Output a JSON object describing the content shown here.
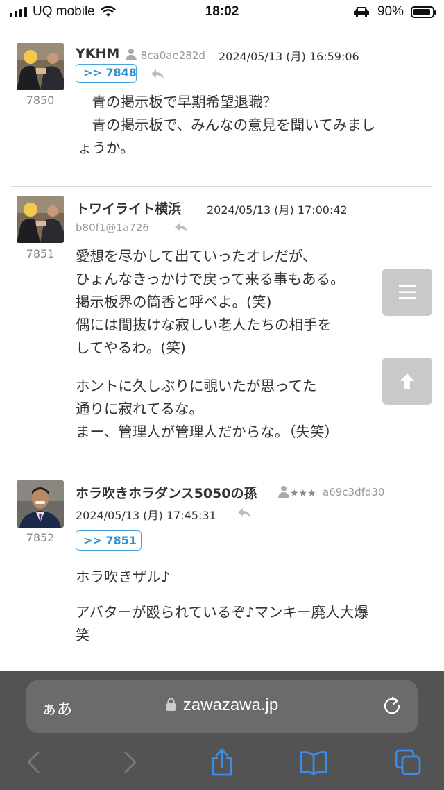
{
  "status_bar": {
    "carrier": "UQ mobile",
    "time": "18:02",
    "battery_percent": "90%"
  },
  "posts": [
    {
      "number": "7850",
      "author": "YKHM",
      "id": "8ca0ae282d",
      "date": "2024/05/13 (月) 16:59:06",
      "reply_to": ">> 7848",
      "paragraphs": [
        "　青の掲示板で早期希望退職？\n　青の掲示板で、みんなの意見を聞いてみまし\nょうか。"
      ]
    },
    {
      "number": "7851",
      "author": "トワイライト横浜",
      "id": "b80f1@1a726",
      "date": "2024/05/13 (月) 17:00:42",
      "paragraphs": [
        "愛想を尽かして出ていったオレだが、\nひょんなきっかけで戻って来る事もある。\n掲示板界の筒香と呼べよ。(笑)\n偶には間抜けな寂しい老人たちの相手を\nしてやるわ。(笑)",
        "ホントに久しぶりに覗いたが思ってた\n通りに寂れてるな。\nまー、管理人が管理人だからな。（失笑）"
      ]
    },
    {
      "number": "7852",
      "author": "ホラ吹きホラダンス5050の孫",
      "rank_stars": "★★★",
      "id": "a69c3dfd30",
      "date": "2024/05/13 (月) 17:45:31",
      "reply_to": ">> 7851",
      "paragraphs": [
        "ホラ吹きザル♪",
        "アバターが殴られているぞ♪マンキー廃人大爆\n笑"
      ]
    }
  ],
  "browser": {
    "text_size_label": "ぁあ",
    "url": "zawazawa.jp"
  },
  "icons": {
    "menu": "menu-icon",
    "scroll_top": "arrow-up-icon",
    "reply": "reply-arrow-icon",
    "user": "person-icon",
    "lock": "lock-icon",
    "reload": "reload-icon",
    "back": "back-arrow-icon",
    "forward": "forward-arrow-icon",
    "share": "share-icon",
    "bookmarks": "book-icon",
    "tabs": "tabs-icon"
  },
  "colors": {
    "reply_badge": "#2e8fd1",
    "browser_bar": "#535353",
    "toolbar_icon": "#3a8eea"
  }
}
